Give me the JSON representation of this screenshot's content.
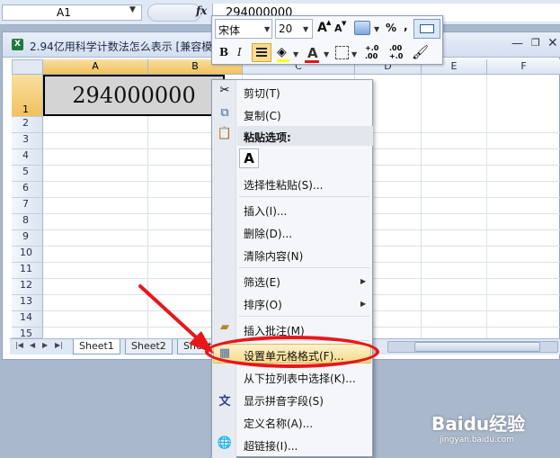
{
  "formula_bar": {
    "name_box": "A1",
    "fx_label": "fx",
    "value": "294000000"
  },
  "workbook": {
    "title": "2.94亿用科学计数法怎么表示  [兼容模",
    "columns": [
      "A",
      "B",
      "C",
      "D",
      "E",
      "F"
    ],
    "rows": [
      "1",
      "2",
      "3",
      "4",
      "5",
      "6",
      "7",
      "8",
      "9",
      "10",
      "11",
      "12",
      "13",
      "14",
      "15"
    ],
    "cell_a1": "294000000",
    "sheets": [
      "Sheet1",
      "Sheet2",
      "Sheet"
    ]
  },
  "mini_toolbar": {
    "font": "宋体",
    "size": "20",
    "grow": "A",
    "shrink": "A",
    "percent": "%",
    "comma": ",",
    "bold": "B",
    "italic": "I",
    "font_color_glyph": "A",
    "inc_decimal": "+.0\n.00",
    "dec_decimal": ".00\n+.0"
  },
  "context_menu": {
    "items": [
      {
        "label": "剪切(T)",
        "icon": "scissors-icon"
      },
      {
        "label": "复制(C)",
        "icon": "copy-icon"
      },
      {
        "label": "粘贴选项:",
        "icon": "clipboard-icon"
      },
      {
        "label": "选择性粘贴(S)...",
        "icon": ""
      },
      {
        "label": "插入(I)...",
        "icon": ""
      },
      {
        "label": "删除(D)...",
        "icon": ""
      },
      {
        "label": "清除内容(N)",
        "icon": ""
      },
      {
        "label": "筛选(E)",
        "icon": ""
      },
      {
        "label": "排序(O)",
        "icon": ""
      },
      {
        "label": "插入批注(M)",
        "icon": "comment-icon"
      },
      {
        "label": "设置单元格格式(F)...",
        "icon": "format-cells-icon"
      },
      {
        "label": "从下拉列表中选择(K)...",
        "icon": ""
      },
      {
        "label": "显示拼音字段(S)",
        "icon": "phonetic-icon"
      },
      {
        "label": "定义名称(A)...",
        "icon": ""
      },
      {
        "label": "超链接(I)...",
        "icon": "hyperlink-icon"
      }
    ],
    "paste_glyph": "A"
  },
  "watermark": {
    "logo": "Baidu经验",
    "sub": "jingyan.baidu.com"
  },
  "colors": {
    "highlight": "#f8da8a",
    "annotation": "#e8171a",
    "selected_header": "#f1c15f"
  }
}
